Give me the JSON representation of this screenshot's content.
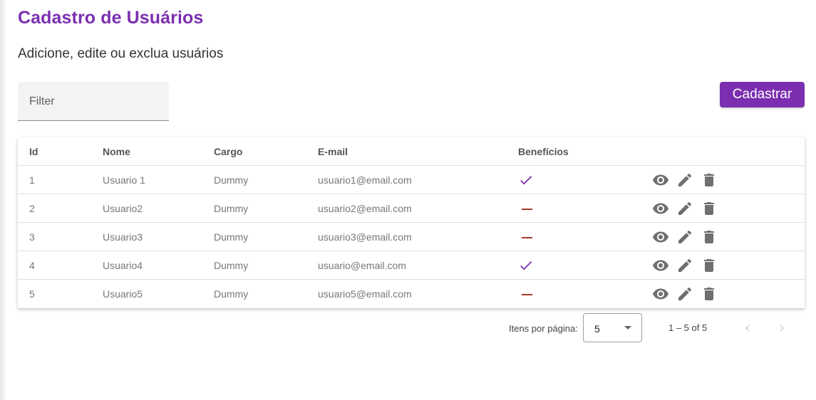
{
  "page": {
    "title": "Cadastro de Usuários",
    "subtitle": "Adicione, edite ou exclua usuários"
  },
  "filter": {
    "placeholder": "Filter",
    "value": ""
  },
  "actions": {
    "add_label": "Cadastrar"
  },
  "table": {
    "columns": [
      "Id",
      "Nome",
      "Cargo",
      "E-mail",
      "Benefícios",
      ""
    ],
    "rows": [
      {
        "id": "1",
        "nome": "Usuario 1",
        "cargo": "Dummy",
        "email": "usuario1@email.com",
        "beneficios": true
      },
      {
        "id": "2",
        "nome": "Usuario2",
        "cargo": "Dummy",
        "email": "usuario2@email.com",
        "beneficios": false
      },
      {
        "id": "3",
        "nome": "Usuario3",
        "cargo": "Dummy",
        "email": "usuario3@email.com",
        "beneficios": false
      },
      {
        "id": "4",
        "nome": "Usuario4",
        "cargo": "Dummy",
        "email": "usuario@email.com",
        "beneficios": true
      },
      {
        "id": "5",
        "nome": "Usuario5",
        "cargo": "Dummy",
        "email": "usuario5@email.com",
        "beneficios": false
      }
    ],
    "row_action_icons": [
      "eye-icon",
      "pencil-icon",
      "trash-icon"
    ],
    "benefit_icons": {
      "true": "check-icon",
      "false": "dash-icon"
    }
  },
  "paginator": {
    "items_per_page_label": "Itens por página:",
    "page_size": "5",
    "range_label": "1 – 5 of 5"
  },
  "colors": {
    "accent": "#7b2fb0",
    "dash": "#a33a2e",
    "icon": "#6f6f6f"
  }
}
